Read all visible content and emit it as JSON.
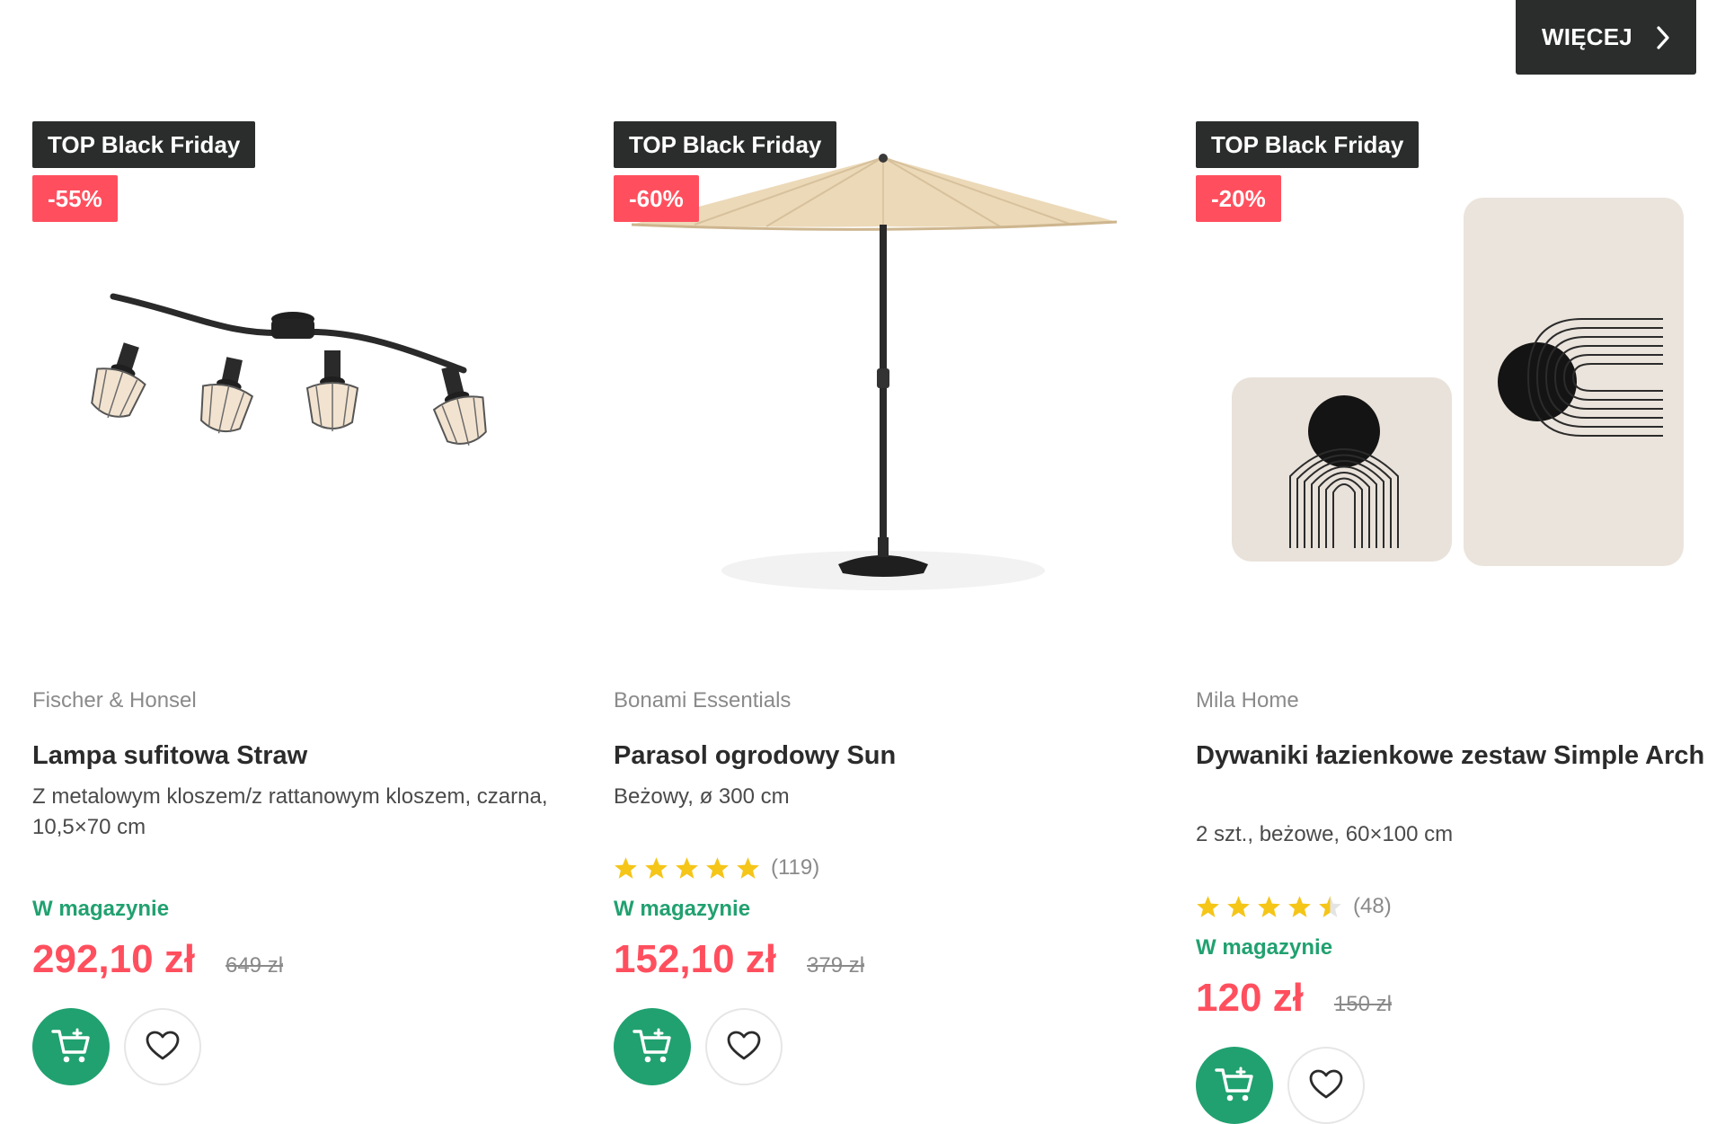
{
  "header": {
    "more_label": "WIĘCEJ"
  },
  "colors": {
    "dark": "#2b2d2d",
    "discount_red": "#ff4f5e",
    "price_red": "#ff4f5e",
    "stock_green": "#21a170",
    "star_yellow": "#f5c518"
  },
  "icons": {
    "more": "chevron-right-icon",
    "cart": "cart-plus-icon",
    "wishlist": "heart-icon",
    "rating": "star-icon"
  },
  "products": [
    {
      "badge": "TOP Black Friday",
      "discount": "-55%",
      "brand": "Fischer & Honsel",
      "title": "Lampa sufitowa Straw",
      "description": "Z metalowym kloszem/z rattanowym kloszem, czarna, 10,5×70 cm",
      "stock": "W magazynie",
      "price": "292,10 zł",
      "old_price": "649 zł",
      "image": "ceiling-lamp-image"
    },
    {
      "badge": "TOP Black Friday",
      "discount": "-60%",
      "brand": "Bonami Essentials",
      "title": "Parasol ogrodowy Sun",
      "description": "Beżowy, ø 300 cm",
      "rating": 5,
      "rating_count": "(119)",
      "stock": "W magazynie",
      "price": "152,10 zł",
      "old_price": "379 zł",
      "image": "garden-umbrella-image"
    },
    {
      "badge": "TOP Black Friday",
      "discount": "-20%",
      "brand": "Mila Home",
      "title": "Dywaniki łazienkowe zestaw Simple Arch",
      "description": "2 szt., beżowe, 60×100 cm",
      "rating": 4.5,
      "rating_count": "(48)",
      "stock": "W magazynie",
      "price": "120 zł",
      "old_price": "150 zł",
      "image": "bath-mats-image"
    }
  ]
}
